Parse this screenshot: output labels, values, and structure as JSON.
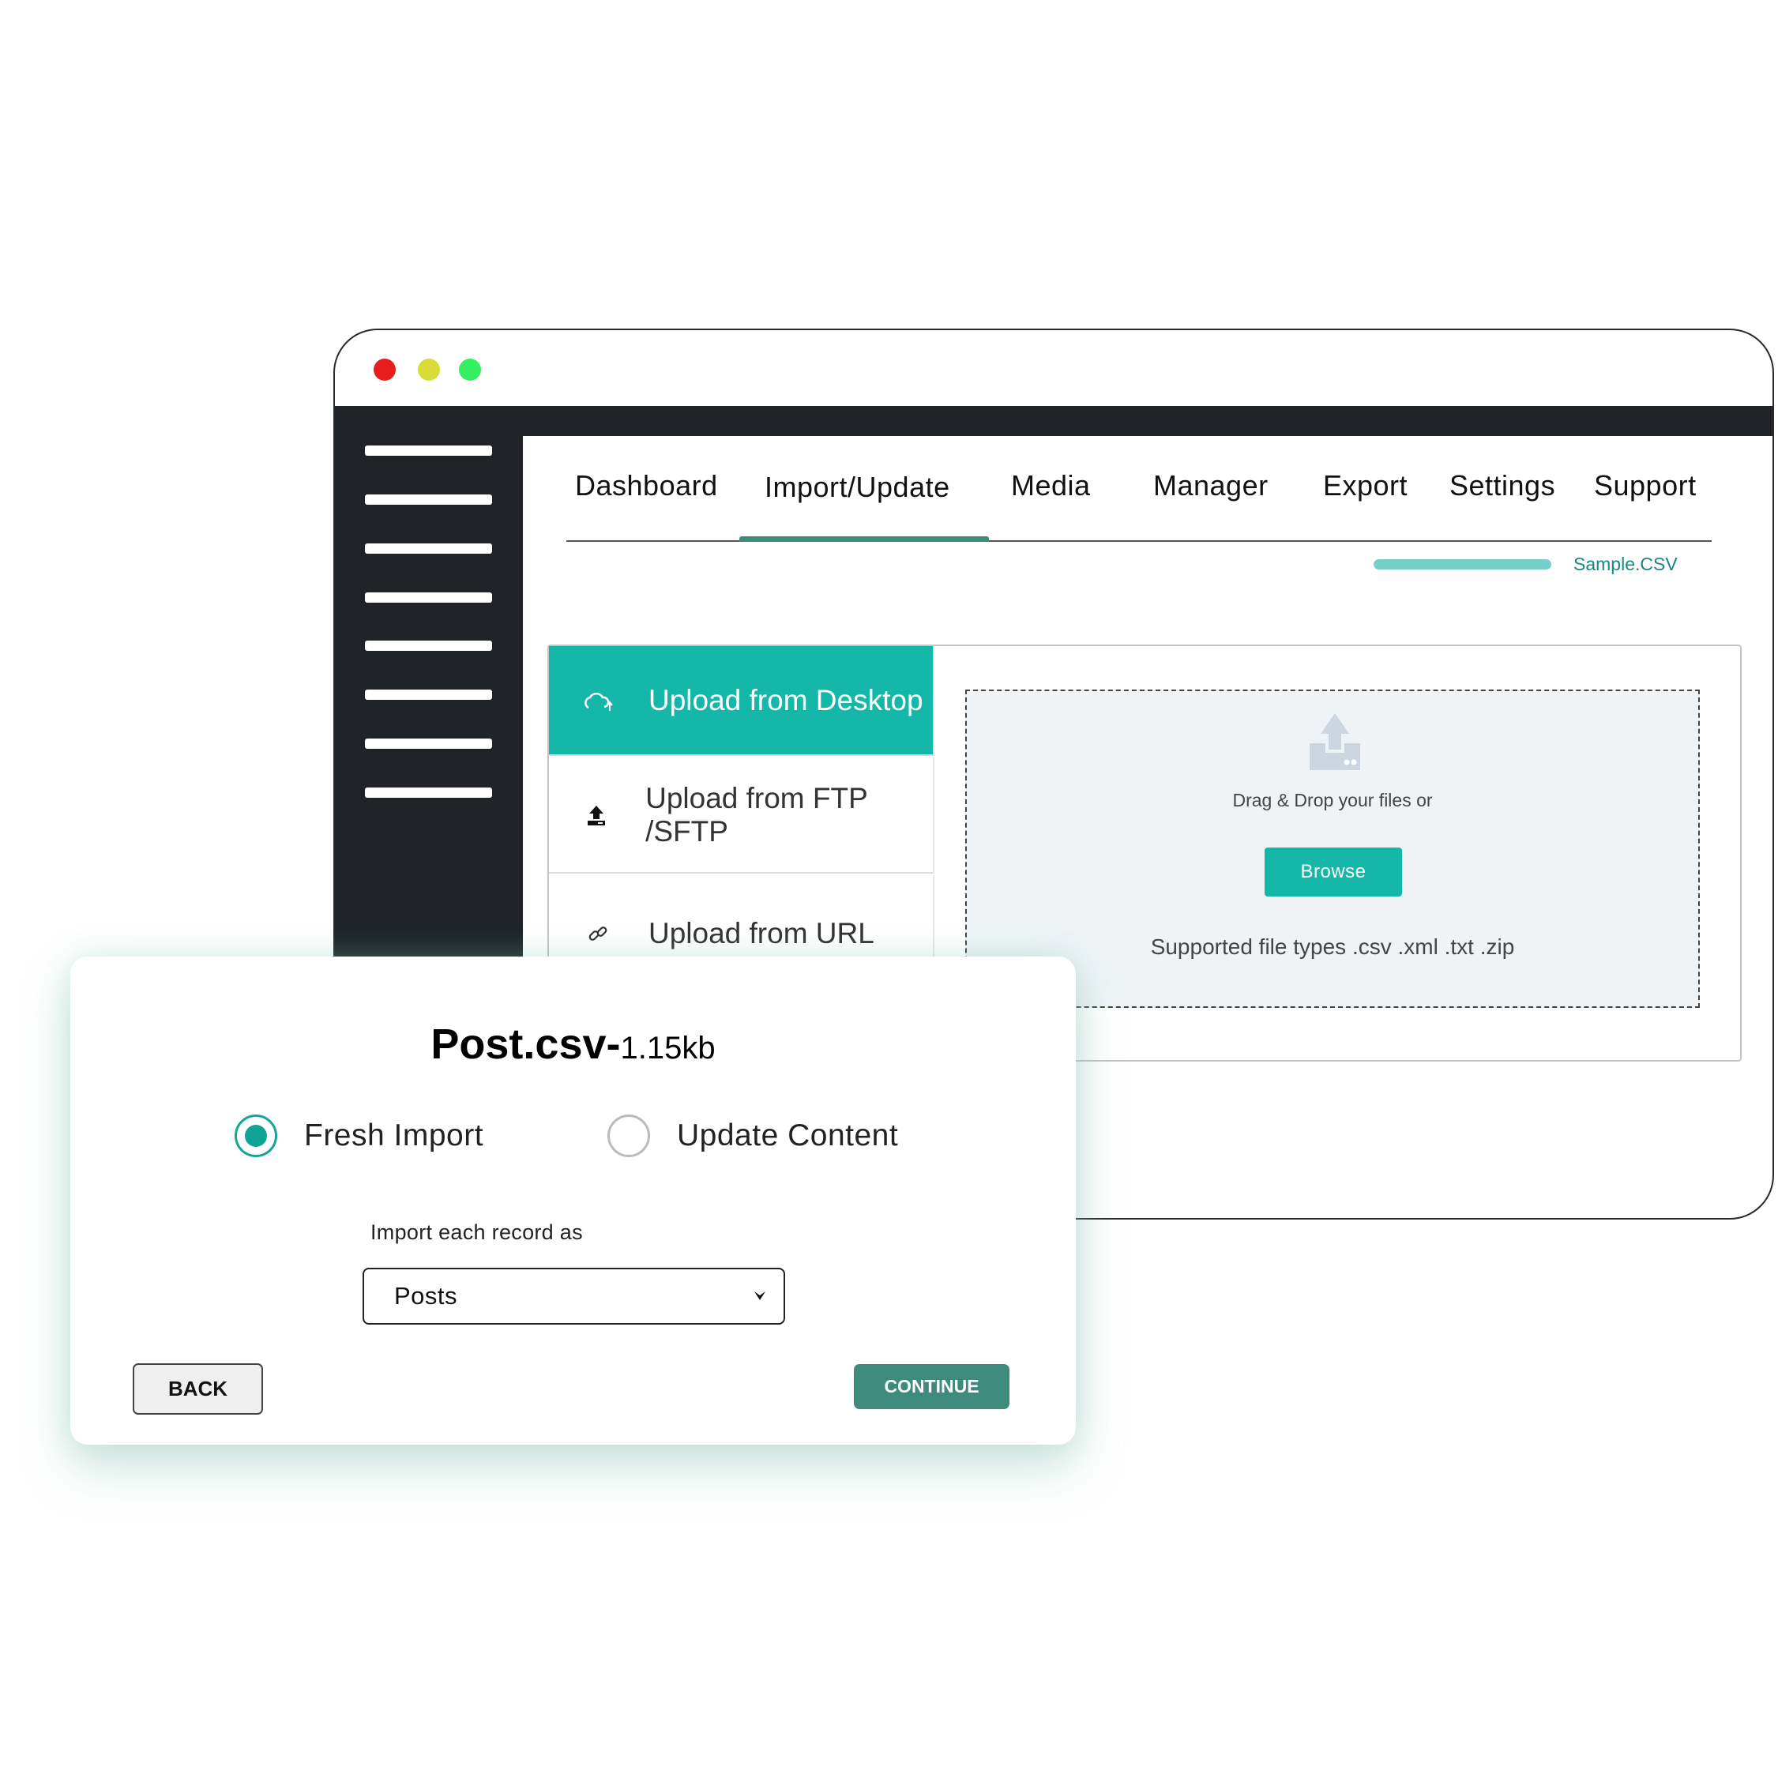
{
  "window": {
    "controls": [
      {
        "name": "close",
        "color": "#e81c1c"
      },
      {
        "name": "minimize",
        "color": "#d9dc38"
      },
      {
        "name": "maximize",
        "color": "#36ee62"
      }
    ],
    "sidebar_item_count": 8
  },
  "nav": {
    "tabs": [
      {
        "label": "Dashboard",
        "active": false
      },
      {
        "label": "Import/Update",
        "active": true
      },
      {
        "label": "Media",
        "active": false
      },
      {
        "label": "Manager",
        "active": false
      },
      {
        "label": "Export",
        "active": false
      },
      {
        "label": "Settings",
        "active": false
      },
      {
        "label": "Support",
        "active": false
      }
    ]
  },
  "upload_progress": {
    "percent": 100,
    "file_name": "Sample.CSV"
  },
  "upload_sources": [
    {
      "label": "Upload from Desktop",
      "icon": "cloud-upload-icon",
      "active": true
    },
    {
      "label": "Upload from FTP /SFTP",
      "icon": "upload-server-icon",
      "active": false
    },
    {
      "label": "Upload from URL",
      "icon": "link-icon",
      "active": false
    }
  ],
  "dropzone": {
    "icon": "upload-tray-icon",
    "prompt": "Drag & Drop your files or",
    "browse_label": "Browse",
    "supported_types": "Supported file types .csv .xml .txt .zip"
  },
  "modal": {
    "file_name": "Post.csv-",
    "file_size": "1.15kb",
    "options": [
      {
        "label": "Fresh Import",
        "checked": true
      },
      {
        "label": "Update Content",
        "checked": false
      }
    ],
    "select_label": "Import each record as",
    "select_value": "Posts",
    "back_label": "BACK",
    "continue_label": "CONTINUE"
  },
  "colors": {
    "accent": "#15b8a8",
    "accent_dark": "#3e8a7b",
    "sidebar": "#202428",
    "progress": "#76cfc7",
    "link_text": "#17887c"
  }
}
